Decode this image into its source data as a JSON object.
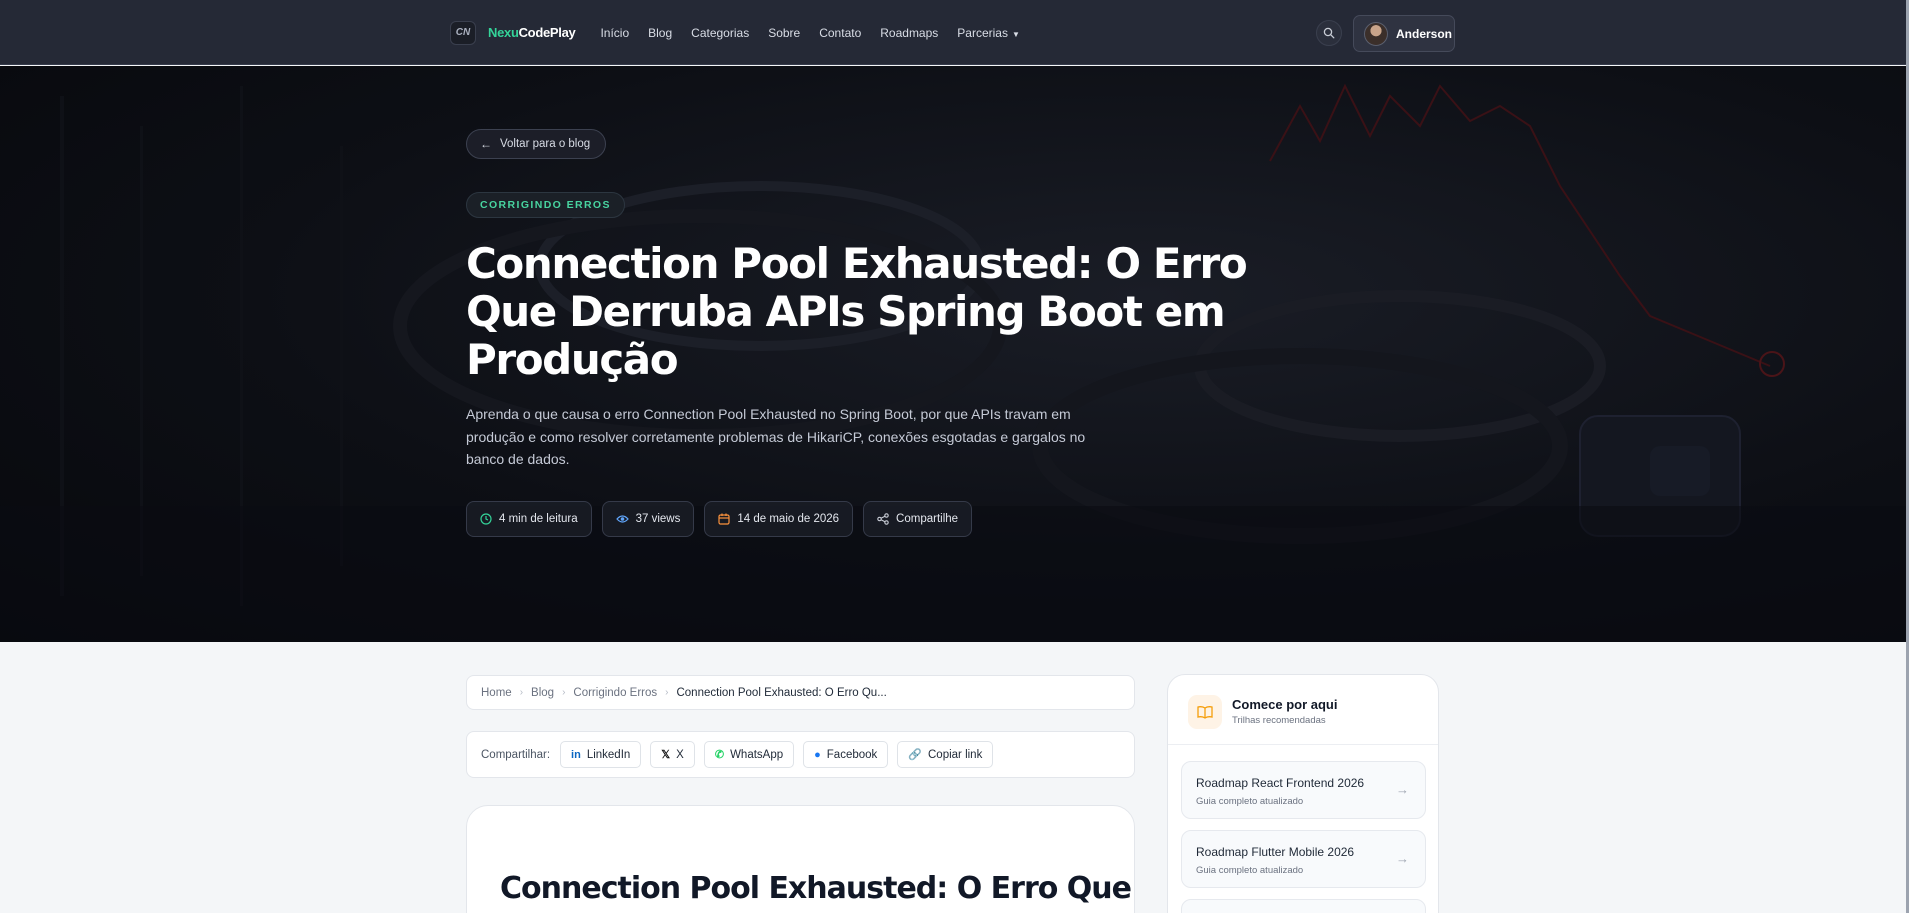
{
  "nav": {
    "logo_mark": "CN",
    "logo_part1": "Nexu",
    "logo_part2": "CodePlay",
    "links": [
      "Início",
      "Blog",
      "Categorias",
      "Sobre",
      "Contato",
      "Roadmaps",
      "Parcerias"
    ],
    "user_name": "Anderson",
    "search_icon": "search-icon"
  },
  "hero": {
    "back_label": "Voltar para o blog",
    "category": "CORRIGINDO ERROS",
    "title": "Connection Pool Exhausted: O Erro Que Derruba APIs Spring Boot em Produção",
    "description": "Aprenda o que causa o erro Connection Pool Exhausted no Spring Boot, por que APIs travam em produção e como resolver corretamente problemas de HikariCP, conexões esgotadas e gargalos no banco de dados.",
    "meta": {
      "read_time": "4 min de leitura",
      "views": "37 views",
      "date": "14 de maio de 2026",
      "share": "Compartilhe"
    }
  },
  "breadcrumb": [
    "Home",
    "Blog",
    "Corrigindo Erros",
    "Connection Pool Exhausted: O Erro Qu..."
  ],
  "share": {
    "label": "Compartilhar:",
    "buttons": [
      "LinkedIn",
      "X",
      "WhatsApp",
      "Facebook",
      "Copiar link"
    ]
  },
  "article": {
    "title": "Connection Pool Exhausted: O Erro Que"
  },
  "sidebar": {
    "title": "Comece por aqui",
    "subtitle": "Trilhas recomendadas",
    "items": [
      {
        "title": "Roadmap React Frontend 2026",
        "subtitle": "Guia completo atualizado"
      },
      {
        "title": "Roadmap Flutter Mobile 2026",
        "subtitle": "Guia completo atualizado"
      }
    ]
  },
  "colors": {
    "accent": "#34d399",
    "nav_bg": "#252936",
    "hero_bg": "#0d0f15"
  }
}
